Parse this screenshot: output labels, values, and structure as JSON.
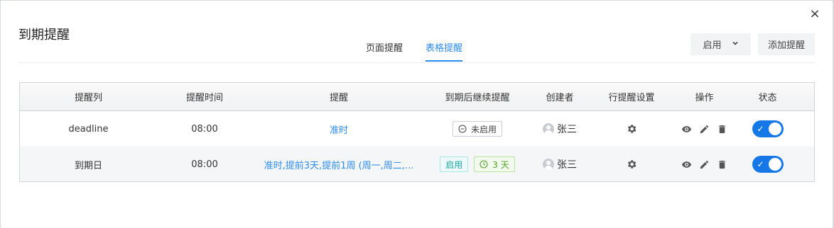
{
  "dialog": {
    "title": "到期提醒",
    "close_label": "×",
    "tabs": [
      {
        "label": "页面提醒",
        "active": false
      },
      {
        "label": "表格提醒",
        "active": true
      }
    ],
    "enable_select": {
      "value": "启用"
    },
    "add_button": "添加提醒"
  },
  "table": {
    "headers": [
      "提醒列",
      "提醒时间",
      "提醒",
      "到期后继续提醒",
      "创建者",
      "行提醒设置",
      "操作",
      "状态"
    ],
    "rows": [
      {
        "column": "deadline",
        "time": "08:00",
        "remind": "准时",
        "continue_tag": "未启用",
        "continue_days": "",
        "creator": "张三",
        "status_on": true,
        "status_check": "✓"
      },
      {
        "column": "到期日",
        "time": "08:00",
        "remind": "准时,提前3天,提前1周 (周一,周二,...",
        "continue_tag": "启用",
        "continue_days": "3 天",
        "creator": "张三",
        "status_on": true,
        "status_check": "✓"
      }
    ]
  },
  "colors": {
    "accent": "#2d8cf0",
    "switch_on": "#1677e6"
  }
}
